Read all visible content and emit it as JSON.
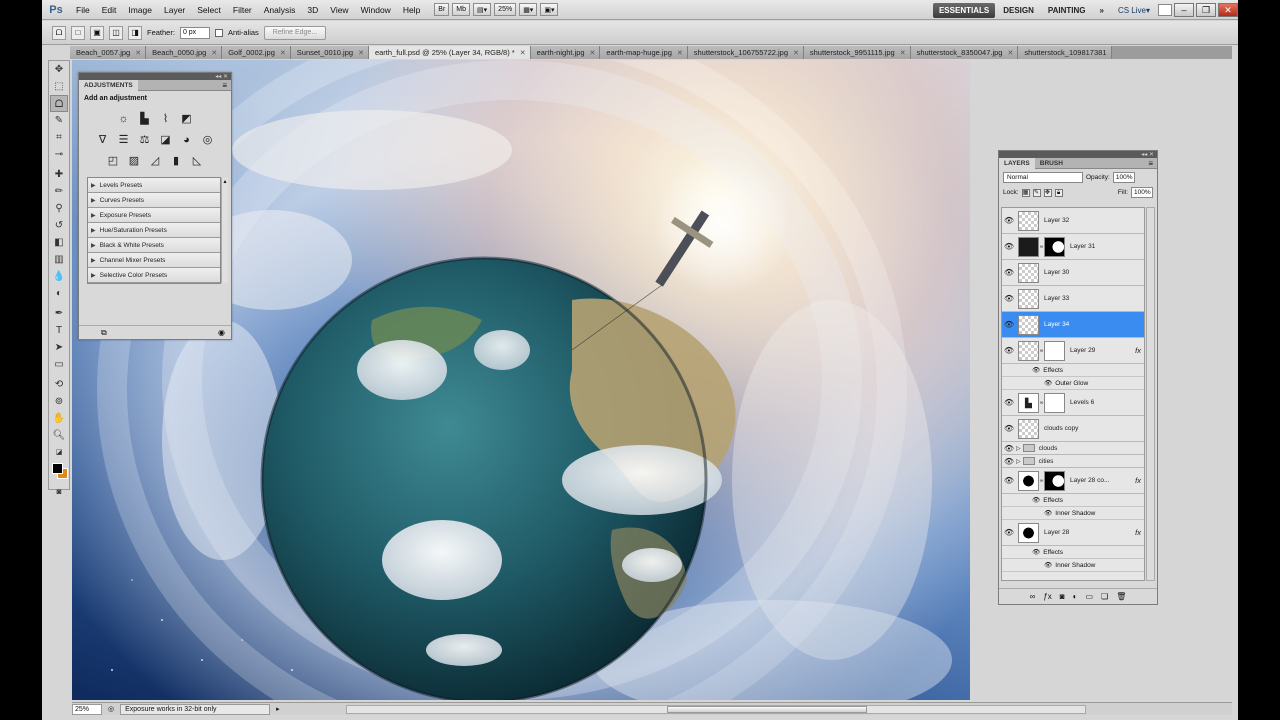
{
  "app": {
    "logo": "Ps"
  },
  "menu": [
    "File",
    "Edit",
    "Image",
    "Layer",
    "Select",
    "Filter",
    "Analysis",
    "3D",
    "View",
    "Window",
    "Help"
  ],
  "menubar_tools": {
    "zoom": "25%",
    "br": "Br",
    "mb": "Mb"
  },
  "workspaces": [
    "ESSENTIALS",
    "DESIGN",
    "PAINTING"
  ],
  "workspace_more": "»",
  "cs_live": "CS Live▾",
  "window_controls": {
    "minimize": "–",
    "restore": "❐",
    "close": "✕"
  },
  "options": {
    "feather_label": "Feather:",
    "feather_value": "0 px",
    "antialias_label": "Anti-alias",
    "refine_label": "Refine Edge..."
  },
  "tabs": [
    {
      "label": "Beach_0057.jpg"
    },
    {
      "label": "Beach_0050.jpg"
    },
    {
      "label": "Golf_0002.jpg"
    },
    {
      "label": "Sunset_0010.jpg"
    },
    {
      "label": "earth_full.psd @ 25% (Layer 34, RGB/8) *"
    },
    {
      "label": "earth-night.jpg"
    },
    {
      "label": "earth-map-huge.jpg"
    },
    {
      "label": "shutterstock_106755722.jpg"
    },
    {
      "label": "shutterstock_9951115.jpg"
    },
    {
      "label": "shutterstock_8350047.jpg"
    },
    {
      "label": "shutterstock_109817381"
    }
  ],
  "tab_close": "✕",
  "adjustments": {
    "tab": "ADJUSTMENTS",
    "heading": "Add an adjustment",
    "presets": [
      "Levels Presets",
      "Curves Presets",
      "Exposure Presets",
      "Hue/Saturation Presets",
      "Black & White Presets",
      "Channel Mixer Presets",
      "Selective Color Presets"
    ]
  },
  "layers": {
    "tabs": [
      "LAYERS",
      "BRUSH"
    ],
    "blend_mode": "Normal",
    "opacity_label": "Opacity:",
    "opacity": "100%",
    "lock_label": "Lock:",
    "fill_label": "Fill:",
    "fill": "100%",
    "items": [
      {
        "name": "Layer 32"
      },
      {
        "name": "Layer 31"
      },
      {
        "name": "Layer 30"
      },
      {
        "name": "Layer 33"
      },
      {
        "name": "Layer 34"
      },
      {
        "name": "Layer 29"
      },
      {
        "name": "Levels 6"
      },
      {
        "name": "clouds copy"
      },
      {
        "name": "clouds"
      },
      {
        "name": "cities"
      },
      {
        "name": "Layer 28 co..."
      },
      {
        "name": "Layer 28"
      }
    ],
    "effects_label": "Effects",
    "outer_glow": "Outer Glow",
    "inner_shadow": "Inner Shadow",
    "fx": "fx"
  },
  "status": {
    "zoom": "25%",
    "message": "Exposure works in 32-bit only"
  },
  "colors": {
    "accent": "#3b8cf0",
    "foreground": "#000000",
    "background": "#e08a1e"
  }
}
